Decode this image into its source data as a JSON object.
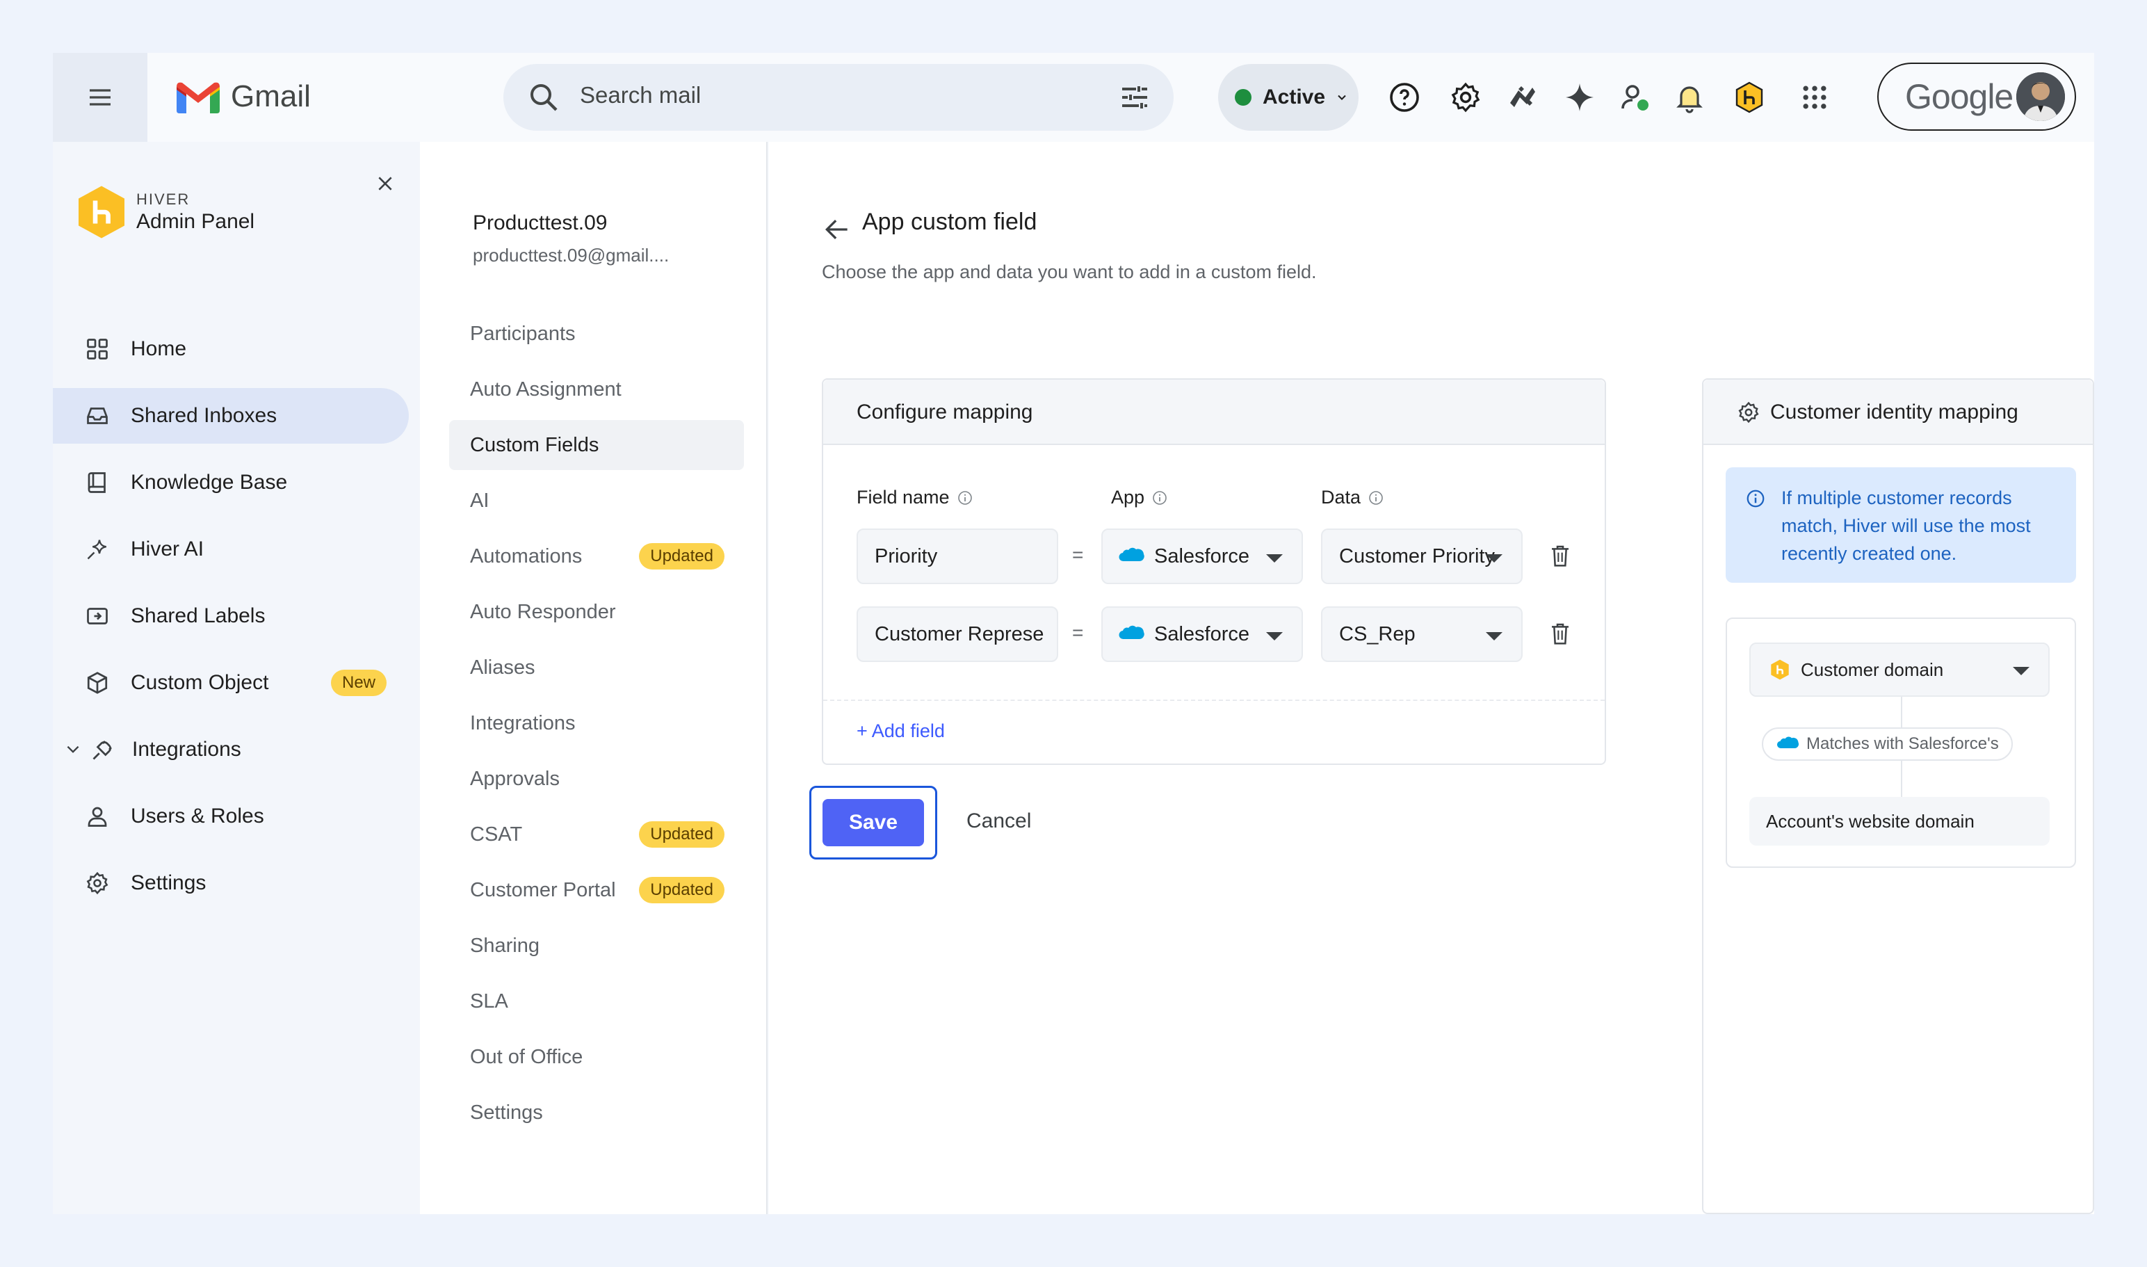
{
  "gmail": {
    "app_name": "Gmail",
    "search_placeholder": "Search mail",
    "status_label": "Active",
    "account_label": "Google"
  },
  "top_icons": [
    "help-icon",
    "settings-icon",
    "apps-extension-icon",
    "gemini-sparkle-icon",
    "contacts-status-icon",
    "notifications-bell-icon",
    "hiver-icon",
    "google-apps-grid-icon"
  ],
  "admin_panel": {
    "brand_small": "HIVER",
    "brand_title": "Admin Panel",
    "nav": [
      {
        "label": "Home",
        "icon": "home-grid-icon"
      },
      {
        "label": "Shared Inboxes",
        "icon": "inbox-icon",
        "active": true
      },
      {
        "label": "Knowledge Base",
        "icon": "book-icon"
      },
      {
        "label": "Hiver AI",
        "icon": "sparkle-icon"
      },
      {
        "label": "Shared Labels",
        "icon": "label-icon"
      },
      {
        "label": "Custom Object",
        "icon": "cube-icon",
        "badge": "New"
      },
      {
        "label": "Integrations",
        "icon": "plug-icon",
        "expandable": true
      },
      {
        "label": "Users & Roles",
        "icon": "user-icon"
      },
      {
        "label": "Settings",
        "icon": "gear-icon"
      }
    ]
  },
  "inbox": {
    "name": "Producttest.09",
    "email": "producttest.09@gmail....",
    "settings": [
      {
        "label": "Participants"
      },
      {
        "label": "Auto Assignment"
      },
      {
        "label": "Custom Fields",
        "active": true
      },
      {
        "label": "AI"
      },
      {
        "label": "Automations",
        "badge": "Updated"
      },
      {
        "label": "Auto Responder"
      },
      {
        "label": "Aliases"
      },
      {
        "label": "Integrations"
      },
      {
        "label": "Approvals"
      },
      {
        "label": "CSAT",
        "badge": "Updated"
      },
      {
        "label": "Customer Portal",
        "badge": "Updated"
      },
      {
        "label": "Sharing"
      },
      {
        "label": "SLA"
      },
      {
        "label": "Out of Office"
      },
      {
        "label": "Settings"
      }
    ]
  },
  "main": {
    "title": "App custom field",
    "subtitle": "Choose the app and data you want to add in a custom field.",
    "configure": {
      "title": "Configure mapping",
      "col_field": "Field name",
      "col_app": "App",
      "col_data": "Data",
      "equals": "=",
      "rows": [
        {
          "field": "Priority",
          "app": "Salesforce",
          "data": "Customer Priority"
        },
        {
          "field": "Customer Represe",
          "app": "Salesforce",
          "data": "CS_Rep"
        }
      ],
      "add_field": "+ Add field"
    },
    "save_label": "Save",
    "cancel_label": "Cancel"
  },
  "identity": {
    "title": "Customer identity mapping",
    "info": "If multiple customer records match, Hiver will use the most recently created one.",
    "domain_select": "Customer domain",
    "match_text": "Matches with Salesforce's",
    "account_field": "Account's website domain"
  },
  "colors": {
    "primary": "#4f63f5",
    "badge_yellow": "#fcd34d",
    "status_green": "#1e8e3e",
    "info_blue": "#1d63c0",
    "active_nav": "#dde5f7"
  }
}
